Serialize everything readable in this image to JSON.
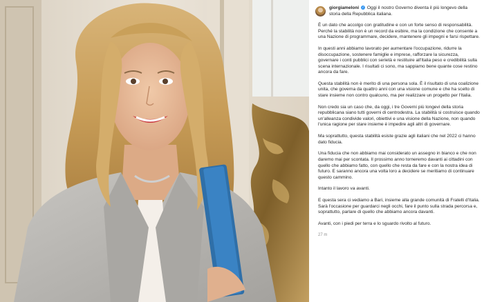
{
  "post": {
    "username": "giorgiameloni",
    "verified_icon": "verified-badge-icon",
    "first_text": "Oggi il nostro Governo diventa il più longevo della storia della Repubblica italiana.",
    "paragraphs": [
      "È un dato che accolgo con gratitudine e con un forte senso di responsabilità. Perché la stabilità non è un record da esibire, ma la condizione che consente a una Nazione di programmare, decidere, mantenere gli impegni e farsi rispettare.",
      "In questi anni abbiamo lavorato per aumentare l'occupazione, ridurre la disoccupazione, sostenere famiglie e imprese, rafforzare la sicurezza, governare i conti pubblici con serietà e restituire all'Italia peso e credibilità sulla scena internazionale. I risultati ci sono, ma sappiamo bene quante cose restino ancora da fare.",
      "Questa stabilità non è merito di una persona sola. È il risultato di una coalizione unita, che governa da quattro anni con una visione comune e che ha scelto di stare insieme non contro qualcuno, ma per realizzare un progetto per l'Italia.",
      "Non credo sia un caso che, da oggi, i tre Governi più longevi della storia repubblicana siano tutti governi di centrodestra. La stabilità si costruisce quando un'alleanza condivide valori, obiettivi e una visione della Nazione, non quando l'unica ragione per stare insieme è impedire agli altri di governare.",
      "Ma soprattutto, questa stabilità esiste grazie agli italiani che nel 2022 ci hanno dato fiducia.",
      "Una fiducia che non abbiamo mai considerato un assegno in bianco e che non daremo mai per scontata. Il prossimo anno torneremo davanti ai cittadini con quello che abbiamo fatto, con quello che resta da fare e con la nostra idea di futuro. E saranno ancora una volta loro a decidere se meritiamo di continuare questo cammino.",
      "Intanto il lavoro va avanti.",
      "E questa sera ci vediamo a Bari, insieme alla grande comunità di Fratelli d'Italia. Sarà l'occasione per guardarci negli occhi, fare il punto sulla strada percorsa e, soprattutto, parlare di quello che abbiamo ancora davanti.",
      "Avanti, con i piedi per terra e lo sguardo rivolto al futuro."
    ],
    "timestamp": "27 m"
  },
  "photo": {
    "subject_icon": "portrait-photo",
    "colors": {
      "hair": "#c9a05a",
      "blazer": "#b8b6b2",
      "folder": "#2f6fa8",
      "wall": "#e4dccf",
      "gold_ornament": "#9c7a3c"
    }
  }
}
